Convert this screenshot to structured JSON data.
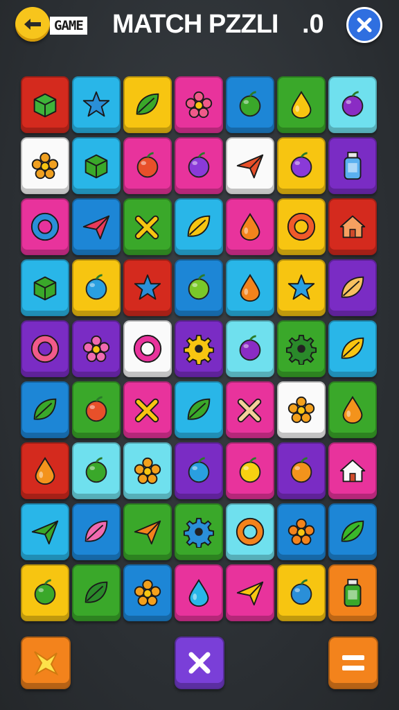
{
  "header": {
    "back_icon": "back-arrow-icon",
    "badge_text": "GAME",
    "title": "MATCH PZZLI",
    "score": ".0",
    "close_icon": "close-icon"
  },
  "colors": {
    "red": "#d42a1e",
    "blue": "#1d86d6",
    "sky": "#29b6e8",
    "yellow": "#f7c511",
    "pink": "#e8339c",
    "green": "#3aa82a",
    "cyan": "#6fe0ee",
    "white": "#fafafa",
    "purple": "#7a2cc4",
    "orange": "#f3831c"
  },
  "grid": {
    "rows": [
      [
        {
          "bg": "red",
          "icon": "green-block",
          "glyph": "block",
          "fg": "#3fb33a"
        },
        {
          "bg": "sky",
          "icon": "blue-star-shape",
          "glyph": "star",
          "fg": "#2a8fd8"
        },
        {
          "bg": "yellow",
          "icon": "green-leaf",
          "glyph": "leaf",
          "fg": "#3aa82a"
        },
        {
          "bg": "pink",
          "icon": "pink-flower",
          "glyph": "flower",
          "fg": "#f05a8a"
        },
        {
          "bg": "blue",
          "icon": "green-red-fruit",
          "glyph": "fruit",
          "fg": "#3aa82a"
        },
        {
          "bg": "green",
          "icon": "yellow-drop",
          "glyph": "drop",
          "fg": "#f7c511"
        },
        {
          "bg": "cyan",
          "icon": "purple-candy",
          "glyph": "circle",
          "fg": "#8a2cc4"
        }
      ],
      [
        {
          "bg": "white",
          "icon": "plant-pot",
          "glyph": "flower",
          "fg": "#f0a020"
        },
        {
          "bg": "sky",
          "icon": "green-castle",
          "glyph": "block",
          "fg": "#3aa82a"
        },
        {
          "bg": "pink",
          "icon": "red-pot",
          "glyph": "circle",
          "fg": "#e8502a"
        },
        {
          "bg": "pink",
          "icon": "purple-plum",
          "glyph": "circle",
          "fg": "#8a3ad8"
        },
        {
          "bg": "white",
          "icon": "paper-plane",
          "glyph": "plane",
          "fg": "#e8502a"
        },
        {
          "bg": "yellow",
          "icon": "purple-plum",
          "glyph": "circle",
          "fg": "#8a3ad8"
        },
        {
          "bg": "purple",
          "icon": "spray-bottle",
          "glyph": "bottle",
          "fg": "#5ab0f0"
        }
      ],
      [
        {
          "bg": "pink",
          "icon": "blue-swirl",
          "glyph": "ring",
          "fg": "#2a8fd8"
        },
        {
          "bg": "blue",
          "icon": "red-plane",
          "glyph": "plane",
          "fg": "#e83a5a"
        },
        {
          "bg": "green",
          "icon": "yellow-cross",
          "glyph": "cross",
          "fg": "#f7c511"
        },
        {
          "bg": "sky",
          "icon": "yellow-banana",
          "glyph": "leaf",
          "fg": "#f7c511"
        },
        {
          "bg": "pink",
          "icon": "orange-drop",
          "glyph": "drop",
          "fg": "#f3831c"
        },
        {
          "bg": "yellow",
          "icon": "orange-donut",
          "glyph": "ring",
          "fg": "#f05a2a"
        },
        {
          "bg": "red",
          "icon": "house",
          "glyph": "house",
          "fg": "#f7a060"
        }
      ],
      [
        {
          "bg": "sky",
          "icon": "green-gem",
          "glyph": "block",
          "fg": "#3aa82a"
        },
        {
          "bg": "yellow",
          "icon": "blue-ball",
          "glyph": "circle",
          "fg": "#2a9fe0"
        },
        {
          "bg": "red",
          "icon": "blue-star",
          "glyph": "star",
          "fg": "#2a8fd8"
        },
        {
          "bg": "blue",
          "icon": "green-lime",
          "glyph": "circle",
          "fg": "#7ac82a"
        },
        {
          "bg": "sky",
          "icon": "orange-fish",
          "glyph": "drop",
          "fg": "#f3831c"
        },
        {
          "bg": "yellow",
          "icon": "blue-star",
          "glyph": "star",
          "fg": "#2a9fe0"
        },
        {
          "bg": "purple",
          "icon": "yellow-bread",
          "glyph": "leaf",
          "fg": "#f7c060"
        }
      ],
      [
        {
          "bg": "purple",
          "icon": "rainbow-swirl",
          "glyph": "ring",
          "fg": "#f05a8a"
        },
        {
          "bg": "purple",
          "icon": "pink-flower",
          "glyph": "flower",
          "fg": "#f06ab0"
        },
        {
          "bg": "white",
          "icon": "pink-magnifier",
          "glyph": "ring",
          "fg": "#e8339c"
        },
        {
          "bg": "purple",
          "icon": "yellow-gear",
          "glyph": "gear",
          "fg": "#f7c511"
        },
        {
          "bg": "cyan",
          "icon": "purple-plum",
          "glyph": "circle",
          "fg": "#8a2cc4"
        },
        {
          "bg": "green",
          "icon": "green-gear",
          "glyph": "gear",
          "fg": "#2a8a2a"
        },
        {
          "bg": "sky",
          "icon": "yellow-bananas",
          "glyph": "leaf",
          "fg": "#f7c511"
        }
      ],
      [
        {
          "bg": "blue",
          "icon": "green-leaf",
          "glyph": "leaf",
          "fg": "#3aa82a"
        },
        {
          "bg": "green",
          "icon": "apples",
          "glyph": "circle",
          "fg": "#e8502a"
        },
        {
          "bg": "pink",
          "icon": "pencil",
          "glyph": "cross",
          "fg": "#f7c511"
        },
        {
          "bg": "sky",
          "icon": "green-pickle",
          "glyph": "leaf",
          "fg": "#3aa82a"
        },
        {
          "bg": "pink",
          "icon": "bone",
          "glyph": "cross",
          "fg": "#f3d09a"
        },
        {
          "bg": "white",
          "icon": "orange-flower",
          "glyph": "flower",
          "fg": "#f3a01c"
        },
        {
          "bg": "green",
          "icon": "orange-pear",
          "glyph": "drop",
          "fg": "#f3931c"
        }
      ],
      [
        {
          "bg": "red",
          "icon": "orange-blob",
          "glyph": "drop",
          "fg": "#f3931c"
        },
        {
          "bg": "cyan",
          "icon": "green-chat",
          "glyph": "circle",
          "fg": "#3aa82a"
        },
        {
          "bg": "cyan",
          "icon": "orange-sun",
          "glyph": "flower",
          "fg": "#f3a01c"
        },
        {
          "bg": "purple",
          "icon": "blue-bomb",
          "glyph": "circle",
          "fg": "#2a9fe0"
        },
        {
          "bg": "pink",
          "icon": "yellow-lemon",
          "glyph": "circle",
          "fg": "#f7d011"
        },
        {
          "bg": "purple",
          "icon": "orange-fruit",
          "glyph": "circle",
          "fg": "#f3931c"
        },
        {
          "bg": "pink",
          "icon": "envelope",
          "glyph": "house",
          "fg": "#fafafa"
        }
      ],
      [
        {
          "bg": "sky",
          "icon": "green-arrow",
          "glyph": "plane",
          "fg": "#3aa82a"
        },
        {
          "bg": "blue",
          "icon": "pink-bean",
          "glyph": "leaf",
          "fg": "#f06ab0"
        },
        {
          "bg": "green",
          "icon": "orange-plane",
          "glyph": "plane",
          "fg": "#f3831c"
        },
        {
          "bg": "green",
          "icon": "blue-gear",
          "glyph": "gear",
          "fg": "#2a8fd8"
        },
        {
          "bg": "cyan",
          "icon": "orange-ring",
          "glyph": "ring",
          "fg": "#f3831c"
        },
        {
          "bg": "blue",
          "icon": "orange-splash",
          "glyph": "flower",
          "fg": "#f3831c"
        },
        {
          "bg": "blue",
          "icon": "green-leaf",
          "glyph": "leaf",
          "fg": "#3ab82a"
        }
      ],
      [
        {
          "bg": "yellow",
          "icon": "green-maracas",
          "glyph": "circle",
          "fg": "#3aa82a"
        },
        {
          "bg": "green",
          "icon": "green-leaf",
          "glyph": "leaf",
          "fg": "#2a8a2a"
        },
        {
          "bg": "blue",
          "icon": "orange-flame",
          "glyph": "flower",
          "fg": "#f3a01c"
        },
        {
          "bg": "pink",
          "icon": "blue-cat",
          "glyph": "drop",
          "fg": "#29b6e8"
        },
        {
          "bg": "pink",
          "icon": "yellow-pyramid",
          "glyph": "plane",
          "fg": "#f7c511"
        },
        {
          "bg": "yellow",
          "icon": "blue-egg",
          "glyph": "circle",
          "fg": "#2a8fd8"
        },
        {
          "bg": "orange",
          "icon": "green-jar",
          "glyph": "bottle",
          "fg": "#3aa82a"
        }
      ]
    ]
  },
  "bottom": {
    "left": {
      "bg": "#f3831c",
      "icon": "star-burst-icon"
    },
    "center": {
      "bg": "#7a3fd8",
      "icon": "x-icon"
    },
    "right": {
      "bg": "#f3831c",
      "icon": "equals-icon"
    }
  }
}
